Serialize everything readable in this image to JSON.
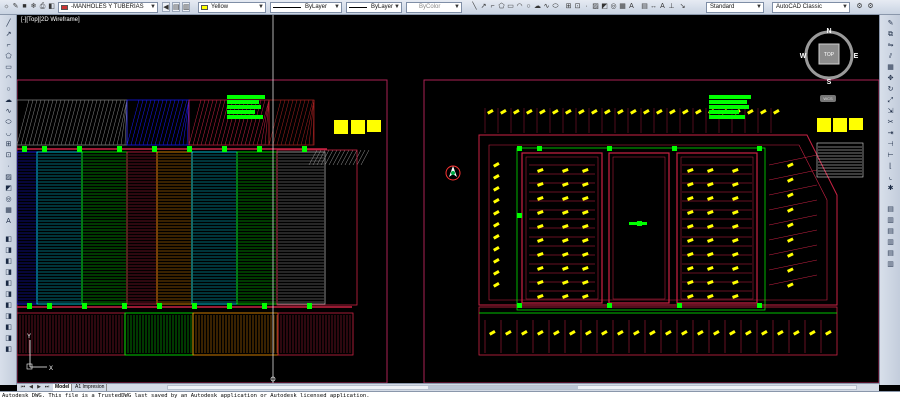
{
  "toolbar": {
    "layer_combo": "-MANHOLES Y TUBERIAS",
    "color_combo": "Yellow",
    "linetype_combo": "ByLayer",
    "lineweight_combo": "ByLayer",
    "plotstyle_combo": "ByColor",
    "textstyle_combo": "Standard",
    "workspace_combo": "AutoCAD Classic"
  },
  "viewport": {
    "label": "[-][Top][2D Wireframe]"
  },
  "viewcube": {
    "top_label": "TOP",
    "north": "N",
    "south": "S",
    "east": "E",
    "west": "W",
    "wcs_label": "WCS"
  },
  "tabs": {
    "model": "Model",
    "layout": "A1 Impresion"
  },
  "command_line": {
    "text": "Autodesk DWG.  This file is a TrustedDWG last saved by an Autodesk application or Autodesk licensed application."
  },
  "colors": {
    "background": "#000000",
    "frame_red": "#cc2244",
    "parking_green": "#00ff00",
    "car_yellow": "#ffff00",
    "hatch_cyan": "#00e5ff",
    "hatch_orange": "#ff9900",
    "hatch_blue": "#1a1aff"
  },
  "icons": [
    "layer-icon",
    "pan-icon",
    "zoom-icon",
    "line-icon",
    "circle-icon",
    "hatch-icon",
    "erase-icon",
    "move-icon"
  ]
}
